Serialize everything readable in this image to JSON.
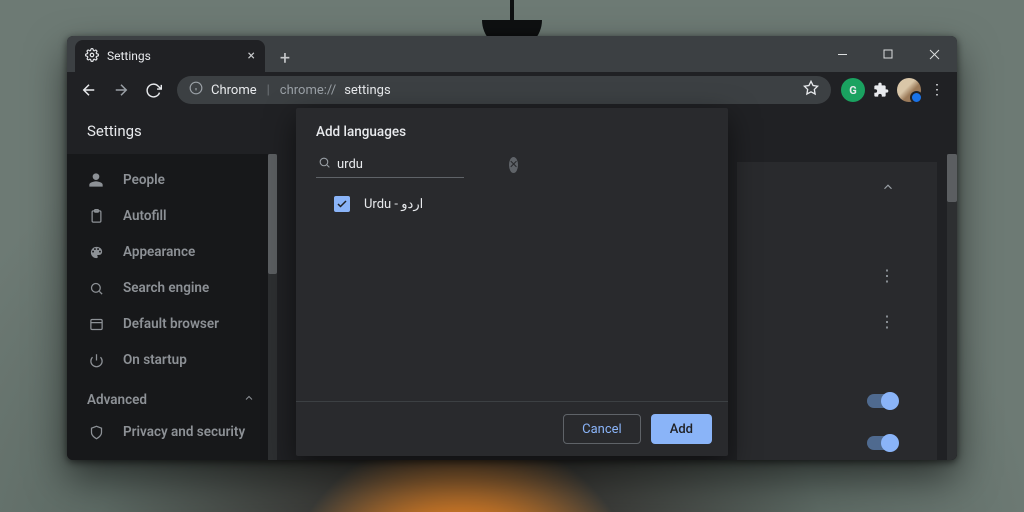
{
  "tab": {
    "title": "Settings"
  },
  "omnibox": {
    "chrome": "Chrome",
    "url_prefix": "chrome://",
    "url_path": "settings"
  },
  "header": {
    "title": "Settings"
  },
  "sidebar": {
    "items": [
      {
        "label": "People"
      },
      {
        "label": "Autofill"
      },
      {
        "label": "Appearance"
      },
      {
        "label": "Search engine"
      },
      {
        "label": "Default browser"
      },
      {
        "label": "On startup"
      }
    ],
    "advanced_label": "Advanced",
    "privacy_label": "Privacy and security"
  },
  "dialog": {
    "title": "Add languages",
    "search_value": "urdu",
    "result_label": "Urdu - اردو",
    "cancel": "Cancel",
    "add": "Add"
  }
}
